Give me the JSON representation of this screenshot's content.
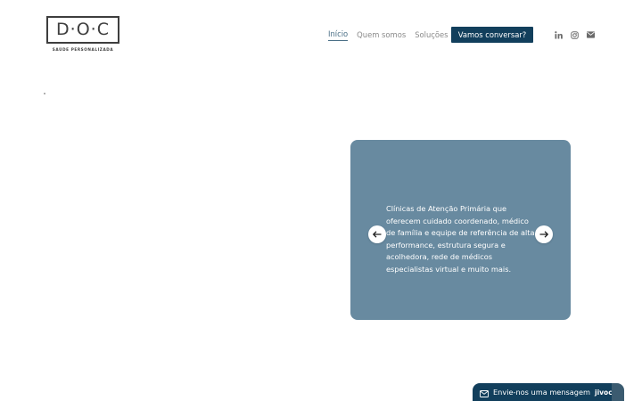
{
  "logo": {
    "mark": "D·O·C",
    "tagline": "SAÚDE PERSONALIZADA"
  },
  "nav": {
    "items": [
      {
        "label": "Início",
        "active": true
      },
      {
        "label": "Quem somos",
        "active": false
      },
      {
        "label": "Soluções",
        "active": false
      }
    ],
    "cta_label": "Vamos conversar?"
  },
  "social": [
    "linkedin-icon",
    "instagram-icon",
    "email-icon"
  ],
  "carousel": {
    "text": "Clínicas de Atenção Primária que oferecem cuidado coordenado, médico de família e equipe de referência de alta performance, estrutura segura e acolhedora, rede de médicos especialistas virtual e muito mais.",
    "card_color": "#688aa0"
  },
  "chat": {
    "label": "Envie-nos uma mensagem",
    "brand": "jivochat"
  },
  "colors": {
    "primary": "#123f5c",
    "card": "#688aa0",
    "text_muted": "#8a8a8a"
  }
}
